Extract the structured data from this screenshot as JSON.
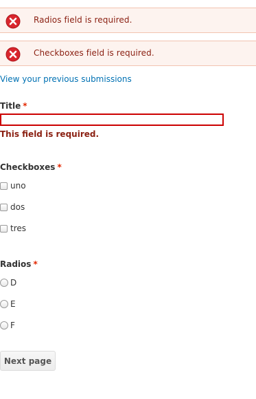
{
  "messages": [
    {
      "text": "Radios field is required.",
      "icon": "error-icon"
    },
    {
      "text": "Checkboxes field is required.",
      "icon": "error-icon"
    }
  ],
  "submissions_link": "View your previous submissions",
  "title_field": {
    "label": "Title",
    "required_mark": "*",
    "value": "",
    "error": "This field is required."
  },
  "checkboxes": {
    "label": "Checkboxes",
    "required_mark": "*",
    "options": [
      "uno",
      "dos",
      "tres"
    ]
  },
  "radios": {
    "label": "Radios",
    "required_mark": "*",
    "options": [
      "D",
      "E",
      "F"
    ]
  },
  "next_button": "Next page",
  "colors": {
    "error_text": "#8a1f11",
    "error_bg": "#fdf3ef",
    "link": "#0071b3",
    "required": "#e32700",
    "input_error_border": "#cc0000"
  }
}
